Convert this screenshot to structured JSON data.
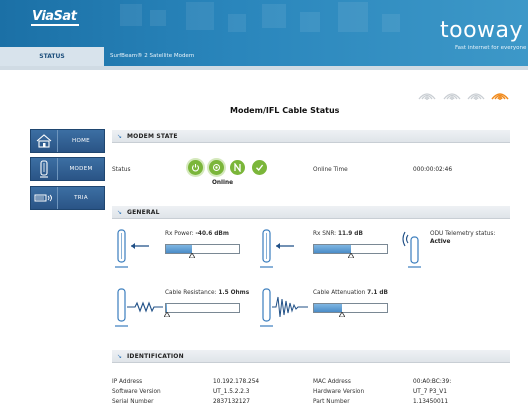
{
  "header": {
    "brand": "ViaSat",
    "product_logo": "tooway",
    "product_tagline": "Fast internet for everyone",
    "tabs": [
      {
        "label": "STATUS",
        "active": true
      },
      {
        "label": "SurfBeam® 2 Satellite Modem",
        "active": false
      }
    ],
    "colors": {
      "header_blue": "#2a86bc",
      "active_tab": "#d8e3ec",
      "nav_blue": "#2f5d91",
      "ok_green": "#7bb63a",
      "signal_active": "#f08a1c"
    }
  },
  "signal_indicator": {
    "bars_total": 4,
    "active_index": 3,
    "icon": "satellite-signal-icon"
  },
  "page_title": "Modem/IFL Cable Status",
  "nav": [
    {
      "label": "HOME",
      "icon": "home-icon"
    },
    {
      "label": "MODEM",
      "icon": "modem-icon"
    },
    {
      "label": "TRIA",
      "icon": "tria-icon"
    }
  ],
  "modem_state": {
    "title": "MODEM STATE",
    "status_label": "Status",
    "status_value": "Online",
    "status_icons": [
      "power-icon",
      "dot-circle-icon",
      "n-circle-icon",
      "check-circle-icon"
    ],
    "online_time_label": "Online Time",
    "online_time_value": "000:00:02:46"
  },
  "general": {
    "title": "GENERAL",
    "rx_power_label": "Rx Power:",
    "rx_power_value": "-40.6 dBm",
    "rx_power_level": 0.35,
    "rx_snr_label": "Rx SNR:",
    "rx_snr_value": "11.9 dB",
    "rx_snr_level": 0.5,
    "odu_label": "ODU Telemetry status:",
    "odu_value": "Active",
    "cable_resistance_label": "Cable Resistance:",
    "cable_resistance_value": "1.5 Ohms",
    "cable_resistance_level": 0.02,
    "cable_attenuation_label": "Cable Attenuation",
    "cable_attenuation_value": "7.1 dB",
    "cable_attenuation_level": 0.38
  },
  "identification": {
    "title": "IDENTIFICATION",
    "ip_label": "IP Address",
    "ip_value": "10.192.178.254",
    "sw_label": "Software Version",
    "sw_value": "UT_1.5.2.2.3",
    "serial_label": "Serial Number",
    "serial_value": "2837132127",
    "mac_label": "MAC Address",
    "mac_value": "00:A0:BC:39:",
    "hw_label": "Hardware Version",
    "hw_value": "UT_7 P3_V1",
    "part_label": "Part Number",
    "part_value": "1.13450011"
  }
}
